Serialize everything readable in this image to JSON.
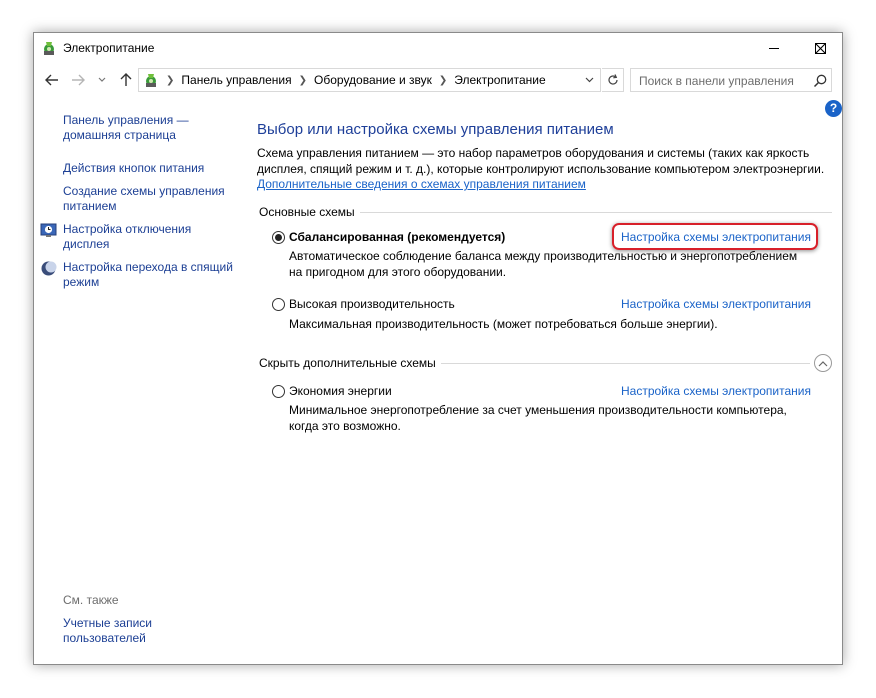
{
  "window": {
    "title": "Электропитание",
    "icons": {
      "app": "power-options-icon",
      "minimize": "minimize-icon",
      "maximize": "maximize-icon",
      "close": "close-icon"
    }
  },
  "navigation": {
    "breadcrumbs": [
      "Панель управления",
      "Оборудование и звук",
      "Электропитание"
    ],
    "search_placeholder": "Поиск в панели управления"
  },
  "sidebar": {
    "home_link": "Панель управления — домашняя страница",
    "links": [
      "Действия кнопок питания",
      "Создание схемы управления питанием",
      "Настройка отключения дисплея",
      "Настройка перехода в спящий режим"
    ],
    "see_also_label": "См. также",
    "see_also_links": [
      "Учетные записи пользователей"
    ]
  },
  "main": {
    "title": "Выбор или настройка схемы управления питанием",
    "intro": "Схема управления питанием — это набор параметров оборудования и системы (таких как яркость дисплея, спящий режим и т. д.), которые контролируют использование компьютером электроэнергии.",
    "intro_link": "Дополнительные сведения о схемах управления питанием",
    "preferred_group_label": "Основные схемы",
    "hidden_group_label": "Скрыть дополнительные схемы",
    "plans": [
      {
        "name": "Сбалансированная (рекомендуется)",
        "description": "Автоматическое соблюдение баланса между производительностью и энергопотреблением на пригодном для этого оборудовании.",
        "link": "Настройка схемы электропитания",
        "selected": true
      },
      {
        "name": "Высокая производительность",
        "description": "Максимальная производительность (может потребоваться больше энергии).",
        "link": "Настройка схемы электропитания",
        "selected": false
      },
      {
        "name": "Экономия энергии",
        "description": "Минимальное энергопотребление за счет уменьшения производительности компьютера, когда это возможно.",
        "link": "Настройка схемы электропитания",
        "selected": false
      }
    ],
    "help_symbol": "?"
  },
  "colors": {
    "link": "#1a63c8",
    "heading": "#1e3f99",
    "highlight": "#d8202a"
  }
}
